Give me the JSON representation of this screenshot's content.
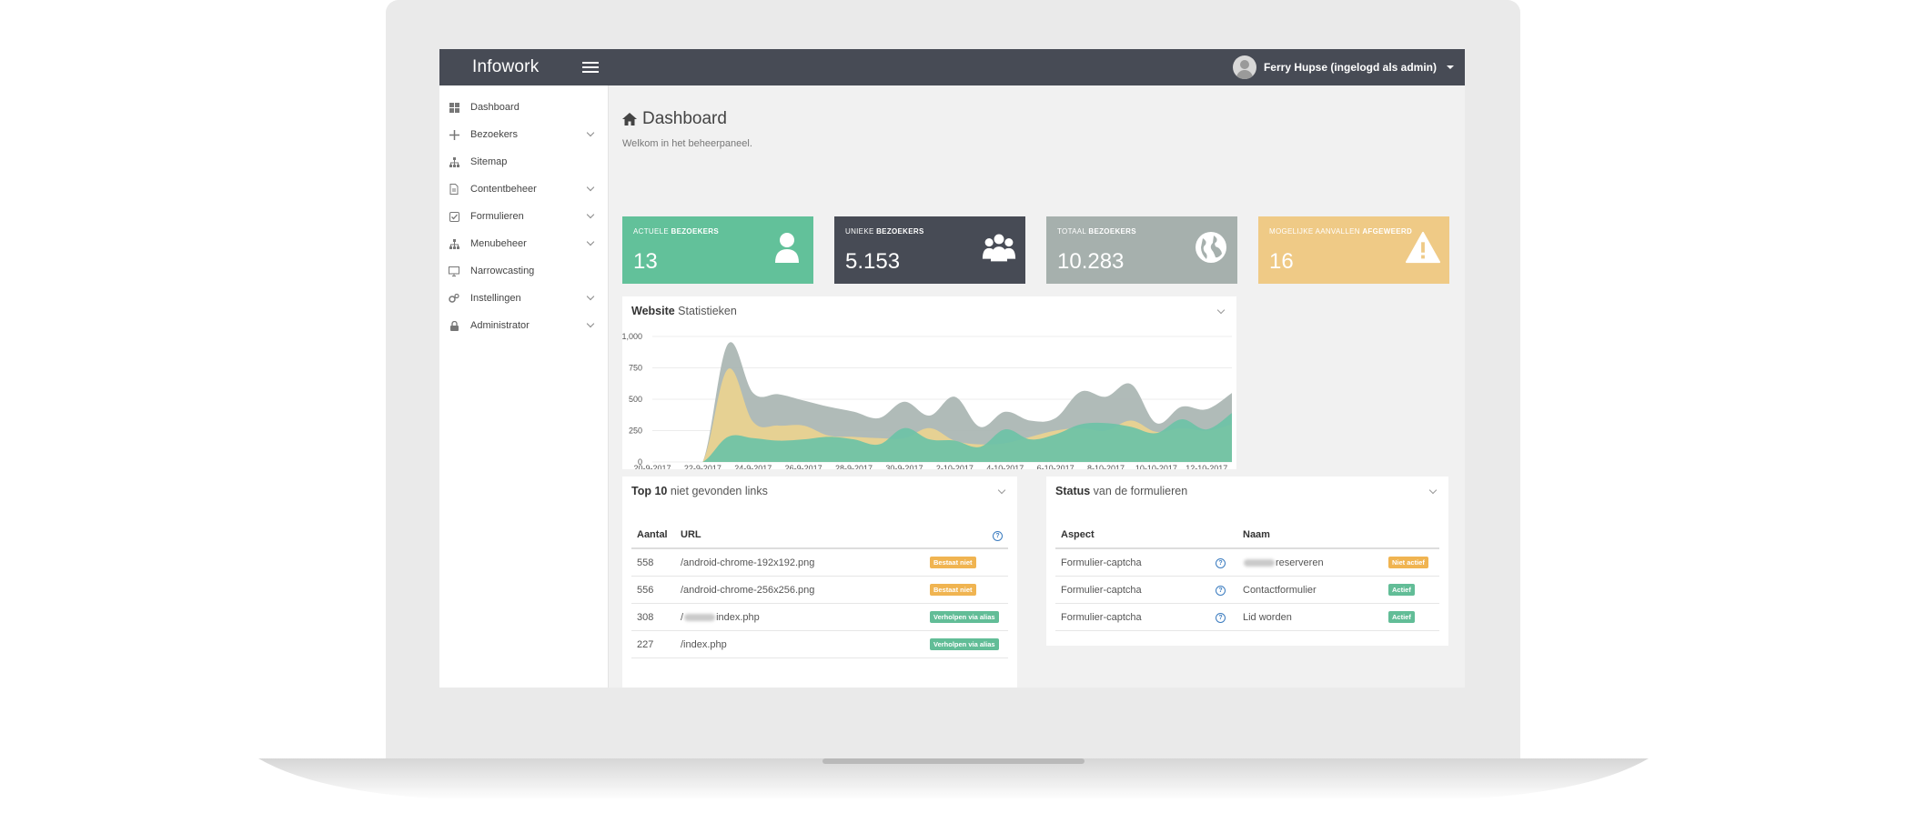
{
  "app": {
    "brand": "Infowork",
    "user_label": "Ferry Hupse (ingelogd als admin)"
  },
  "sidebar": {
    "items": [
      {
        "label": "Dashboard",
        "icon": "dashboard-icon",
        "chevron": false
      },
      {
        "label": "Bezoekers",
        "icon": "arrows-icon",
        "chevron": true
      },
      {
        "label": "Sitemap",
        "icon": "sitemap-icon",
        "chevron": false
      },
      {
        "label": "Contentbeheer",
        "icon": "file-icon",
        "chevron": true
      },
      {
        "label": "Formulieren",
        "icon": "check-square-icon",
        "chevron": true
      },
      {
        "label": "Menubeheer",
        "icon": "sitemap-icon",
        "chevron": true
      },
      {
        "label": "Narrowcasting",
        "icon": "monitor-icon",
        "chevron": false
      },
      {
        "label": "Instellingen",
        "icon": "cogs-icon",
        "chevron": true
      },
      {
        "label": "Administrator",
        "icon": "lock-icon",
        "chevron": true
      }
    ]
  },
  "page": {
    "title": "Dashboard",
    "subtitle": "Welkom in het beheerpaneel."
  },
  "stats": [
    {
      "label_pre": "Actuele ",
      "label_bold": "bezoekers",
      "value": "13",
      "color": "#62c19a",
      "icon": "user-icon"
    },
    {
      "label_pre": "Unieke ",
      "label_bold": "bezoekers",
      "value": "5.153",
      "color": "#474b55",
      "icon": "users-icon"
    },
    {
      "label_pre": "Totaal ",
      "label_bold": "bezoekers",
      "value": "10.283",
      "color": "#a6b0ad",
      "icon": "globe-icon"
    },
    {
      "label_pre": "Mogelijke aanvallen ",
      "label_bold": "afgeweerd",
      "value": "16",
      "color": "#efca86",
      "icon": "warning-icon"
    }
  ],
  "stats_panel": {
    "title_bold": "Website",
    "title_rest": " Statistieken"
  },
  "chart_data": {
    "type": "area",
    "title": "",
    "xlabel": "",
    "ylabel": "",
    "ylim": [
      0,
      1000
    ],
    "yticks": [
      "0",
      "250",
      "500",
      "750",
      "1,000"
    ],
    "x": [
      "20-9-2017",
      "21-9-2017",
      "22-9-2017",
      "23-9-2017",
      "24-9-2017",
      "25-9-2017",
      "26-9-2017",
      "27-9-2017",
      "28-9-2017",
      "29-9-2017",
      "30-9-2017",
      "1-10-2017",
      "2-10-2017",
      "3-10-2017",
      "4-10-2017",
      "5-10-2017",
      "6-10-2017",
      "7-10-2017",
      "8-10-2017",
      "9-10-2017",
      "10-10-2017",
      "11-10-2017",
      "12-10-2017",
      "13-10-2017"
    ],
    "xtick_labels": [
      "20-9-2017",
      "22-9-2017",
      "24-9-2017",
      "26-9-2017",
      "28-9-2017",
      "30-9-2017",
      "2-10-2017",
      "4-10-2017",
      "6-10-2017",
      "8-10-2017",
      "10-10-2017",
      "12-10-2017"
    ],
    "series": [
      {
        "values": [
          0,
          0,
          0,
          940,
          550,
          540,
          490,
          440,
          400,
          350,
          480,
          370,
          520,
          280,
          400,
          330,
          350,
          560,
          520,
          620,
          310,
          440,
          420,
          550
        ],
        "color": "#a9b5b2"
      },
      {
        "values": [
          0,
          0,
          0,
          740,
          320,
          290,
          290,
          210,
          200,
          190,
          190,
          270,
          170,
          140,
          150,
          200,
          250,
          270,
          250,
          330,
          240,
          270,
          250,
          300
        ],
        "color": "#ead28f"
      },
      {
        "values": [
          0,
          0,
          0,
          200,
          190,
          170,
          180,
          200,
          180,
          140,
          270,
          180,
          170,
          120,
          260,
          180,
          220,
          300,
          310,
          280,
          230,
          340,
          260,
          390
        ],
        "color": "#6cc2a6"
      }
    ]
  },
  "links_panel": {
    "title_bold": "Top 10",
    "title_rest": " niet gevonden links",
    "col_count": "Aantal",
    "col_url": "URL",
    "rows": [
      {
        "count": "558",
        "url": "/android-chrome-192x192.png",
        "url_blur_pre": "",
        "badge": "Bestaat niet",
        "badge_type": "warn"
      },
      {
        "count": "556",
        "url": "/android-chrome-256x256.png",
        "url_blur_pre": "",
        "badge": "Bestaat niet",
        "badge_type": "warn"
      },
      {
        "count": "308",
        "url_prefix": "/",
        "url": "index.php",
        "badge": "Verholpen via alias",
        "badge_type": "ok"
      },
      {
        "count": "227",
        "url": "/index.php",
        "url_blur_pre": "",
        "badge": "Verholpen via alias",
        "badge_type": "ok"
      }
    ]
  },
  "forms_panel": {
    "title_bold": "Status",
    "title_rest": " van de formulieren",
    "col_aspect": "Aspect",
    "col_name": "Naam",
    "rows": [
      {
        "aspect": "Formulier-captcha",
        "name": "reserveren",
        "blurred_prefix": true,
        "badge": "Niet actief",
        "badge_type": "warn"
      },
      {
        "aspect": "Formulier-captcha",
        "name": "Contactformulier",
        "blurred_prefix": false,
        "badge": "Actief",
        "badge_type": "ok"
      },
      {
        "aspect": "Formulier-captcha",
        "name": "Lid worden",
        "blurred_prefix": false,
        "badge": "Actief",
        "badge_type": "ok"
      }
    ]
  }
}
